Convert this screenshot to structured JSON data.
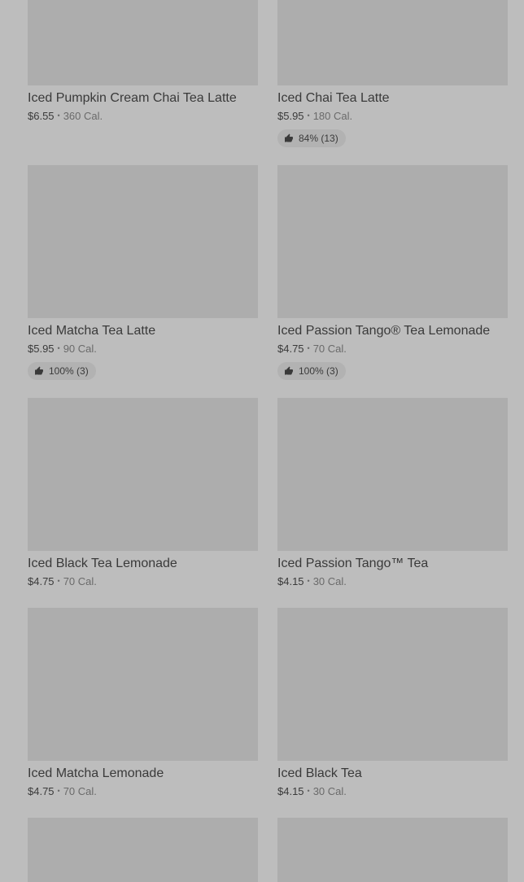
{
  "products": [
    {
      "name": "Iced Pumpkin Cream Chai Tea Latte",
      "price": "$6.55",
      "calories": "360 Cal.",
      "rating": null
    },
    {
      "name": "Iced Chai Tea Latte",
      "price": "$5.95",
      "calories": "180 Cal.",
      "rating": "84% (13)"
    },
    {
      "name": "Iced Matcha Tea Latte",
      "price": "$5.95",
      "calories": "90 Cal.",
      "rating": "100% (3)"
    },
    {
      "name": "Iced Passion Tango® Tea Lemonade",
      "price": "$4.75",
      "calories": "70 Cal.",
      "rating": "100% (3)"
    },
    {
      "name": "Iced Black Tea Lemonade",
      "price": "$4.75",
      "calories": "70 Cal.",
      "rating": null
    },
    {
      "name": "Iced Passion Tango™ Tea",
      "price": "$4.15",
      "calories": "30 Cal.",
      "rating": null
    },
    {
      "name": "Iced Matcha Lemonade",
      "price": "$4.75",
      "calories": "70 Cal.",
      "rating": null
    },
    {
      "name": "Iced Black Tea",
      "price": "$4.15",
      "calories": "30 Cal.",
      "rating": null
    },
    {
      "name": "",
      "price": "",
      "calories": "",
      "rating": null
    },
    {
      "name": "",
      "price": "",
      "calories": "",
      "rating": null
    }
  ],
  "separator": "•",
  "icons": {
    "rating": "thumbs-up-icon"
  },
  "colors": {
    "background": "#bdbdbd",
    "placeholder": "#adadad",
    "text": "#3a3a3a",
    "muted": "#6a6a6a"
  }
}
